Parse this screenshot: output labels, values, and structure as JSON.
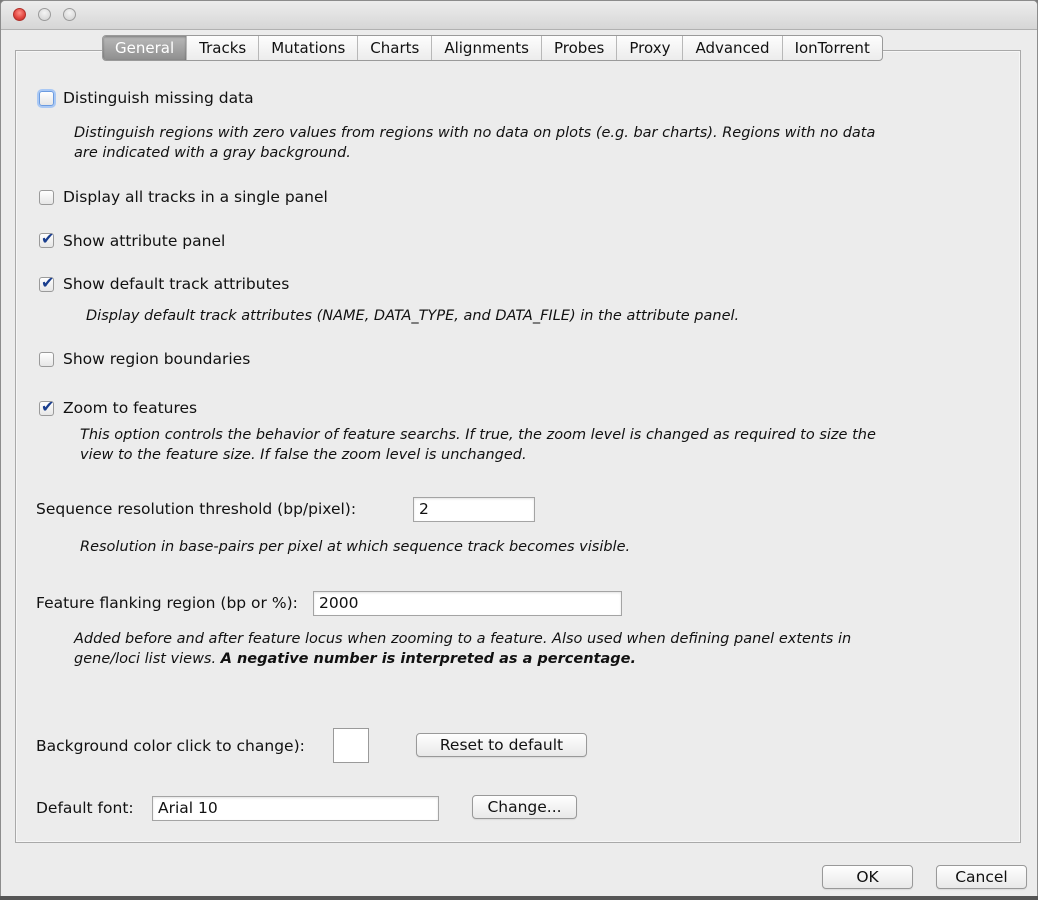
{
  "tabs": [
    "General",
    "Tracks",
    "Mutations",
    "Charts",
    "Alignments",
    "Probes",
    "Proxy",
    "Advanced",
    "IonTorrent"
  ],
  "active_tab": "General",
  "options": {
    "distinguish_missing": {
      "label": "Distinguish missing data",
      "checked": false,
      "desc_line1": "Distinguish regions with zero values from regions with no data on plots (e.g. bar charts). Regions with no data",
      "desc_line2": "are indicated with a gray background."
    },
    "single_panel": {
      "label": "Display all tracks in a single panel",
      "checked": false
    },
    "attribute_panel": {
      "label": "Show attribute panel",
      "checked": true
    },
    "default_attributes": {
      "label": "Show default track attributes",
      "checked": true,
      "desc": "Display default track attributes (NAME, DATA_TYPE, and DATA_FILE) in the attribute panel."
    },
    "region_boundaries": {
      "label": "Show region boundaries",
      "checked": false
    },
    "zoom_features": {
      "label": "Zoom to features",
      "checked": true,
      "desc_line1": "This option controls the behavior of feature searchs. If true, the zoom level is changed as required to size the",
      "desc_line2": "view to the feature size. If false the zoom level is unchanged."
    }
  },
  "sequence_threshold": {
    "label": "Sequence resolution threshold (bp/pixel):",
    "value": "2",
    "desc": "Resolution in base-pairs per pixel at which sequence track becomes visible."
  },
  "flanking": {
    "label": "Feature flanking region (bp or %):",
    "value": "2000",
    "desc_line1": "Added before and after feature locus when zooming to a feature. Also used when defining panel extents in",
    "desc_line2_plain": "gene/loci list views. ",
    "desc_line2_bold": "A negative number is interpreted as a percentage."
  },
  "background": {
    "label": "Background color click to change):",
    "reset_label": "Reset to default",
    "color": "#ffffff"
  },
  "font": {
    "label": "Default font:",
    "value": "Arial 10",
    "change_label": "Change..."
  },
  "buttons": {
    "ok": "OK",
    "cancel": "Cancel"
  }
}
